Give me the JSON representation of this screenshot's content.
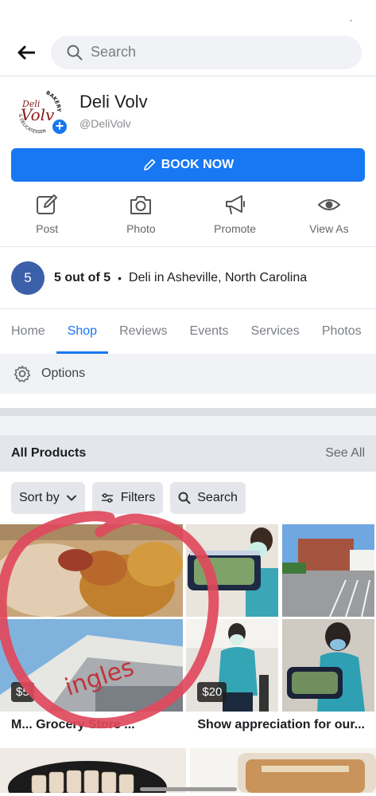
{
  "status_bar": {
    "tick": ","
  },
  "top_bar": {
    "search_placeholder": "Search"
  },
  "page": {
    "name": "Deli Volv",
    "handle": "@DeliVolv",
    "logo_text": "Volv",
    "logo_small": "Deli",
    "logo_ring_top": "BAKERY",
    "logo_ring_bottom": "& DELICATESSEN"
  },
  "book_button": {
    "label": "BOOK NOW"
  },
  "actions": [
    {
      "label": "Post",
      "icon": "edit-icon"
    },
    {
      "label": "Photo",
      "icon": "camera-icon"
    },
    {
      "label": "Promote",
      "icon": "megaphone-icon"
    },
    {
      "label": "View As",
      "icon": "eye-icon"
    }
  ],
  "rating": {
    "score": "5",
    "text": "5 out of 5",
    "separator": "•",
    "category": "Deli in Asheville, North Carolina"
  },
  "tabs": [
    {
      "label": "Home"
    },
    {
      "label": "Shop",
      "active": true
    },
    {
      "label": "Reviews"
    },
    {
      "label": "Events"
    },
    {
      "label": "Services"
    },
    {
      "label": "Photos"
    }
  ],
  "options": {
    "label": "Options"
  },
  "products_header": {
    "title": "All Products",
    "see_all": "See All"
  },
  "filter_chips": {
    "sort_by": "Sort by",
    "filters": "Filters",
    "search": "Search"
  },
  "products": [
    {
      "price": "$5",
      "title": "M... Grocery Store ..."
    },
    {
      "price": "$20",
      "title": "Show appreciation for our..."
    }
  ],
  "colors": {
    "accent": "#1877f2",
    "rating_badge": "#3b5fa8",
    "annotation": "#e0495c"
  }
}
